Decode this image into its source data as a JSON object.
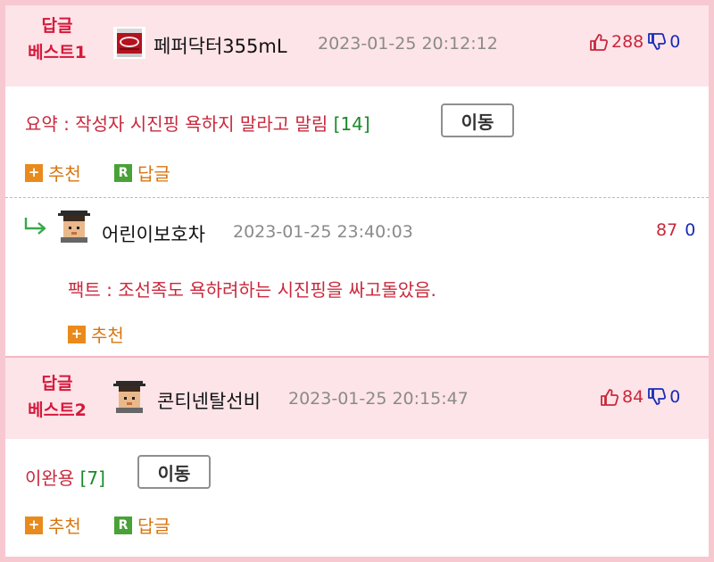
{
  "comments": [
    {
      "best_label": [
        "답글",
        "베스트1"
      ],
      "author": "페퍼닥터355mL",
      "date": "2023-01-25 20:12:12",
      "upvotes": "288",
      "downvotes": "0",
      "text": "요약 : 작성자 시진핑 욕하지 말라고 말림",
      "reply_count": "[14]",
      "move_label": "이동",
      "recommend_label": "추천",
      "reply_label": "답글",
      "avatar": "dr-pepper-can-icon"
    },
    {
      "author": "어린이보호차",
      "date": "2023-01-25 23:40:03",
      "upvotes": "87",
      "downvotes": "0",
      "text": "팩트 : 조선족도 욕하려하는 시진핑을 싸고돌았음.",
      "recommend_label": "추천",
      "avatar": "pixel-graduate-icon"
    },
    {
      "best_label": [
        "답글",
        "베스트2"
      ],
      "author": "콘티넨탈선비",
      "date": "2023-01-25 20:15:47",
      "upvotes": "84",
      "downvotes": "0",
      "text": "이완용",
      "reply_count": "[7]",
      "move_label": "이동",
      "recommend_label": "추천",
      "reply_label": "답글",
      "avatar": "pixel-graduate-icon"
    }
  ],
  "colors": {
    "best_label": "#d6183b",
    "comment_text": "#c8283c",
    "reply_count": "#1b8a2a",
    "action": "#d87510",
    "downvote": "#1a2bb8",
    "header_bg": "#fde4e8"
  }
}
